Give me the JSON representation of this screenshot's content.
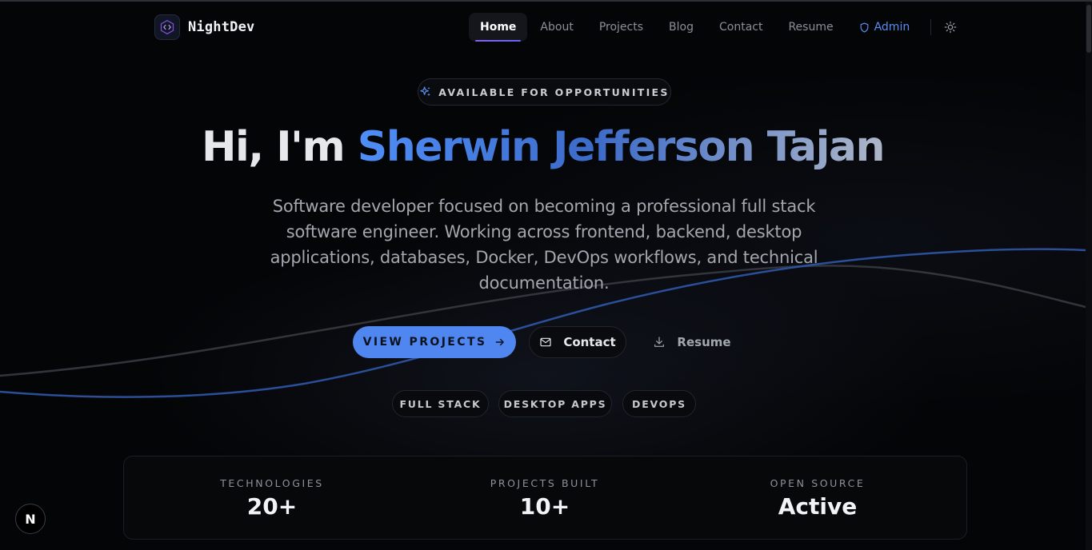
{
  "brand": {
    "name": "NightDev",
    "logo_icon": "code-hexagon-icon"
  },
  "nav": {
    "items": [
      {
        "label": "Home",
        "active": true
      },
      {
        "label": "About"
      },
      {
        "label": "Projects"
      },
      {
        "label": "Blog"
      },
      {
        "label": "Contact"
      },
      {
        "label": "Resume"
      }
    ],
    "admin_label": "Admin",
    "admin_icon": "shield-icon",
    "theme_icon": "sun-icon"
  },
  "hero": {
    "badge": "AVAILABLE FOR OPPORTUNITIES",
    "badge_icon": "sparkles-icon",
    "title_prefix": "Hi, I'm ",
    "title_name": "Sherwin Jefferson Tajan",
    "description": "Software developer focused on becoming a professional full stack software engineer. Working across frontend, backend, desktop applications, databases, Docker, DevOps workflows, and technical documentation."
  },
  "actions": {
    "primary": "VIEW PROJECTS",
    "primary_icon": "arrow-right-icon",
    "contact": "Contact",
    "contact_icon": "mail-icon",
    "resume": "Resume",
    "resume_icon": "download-icon"
  },
  "tags": [
    "FULL STACK",
    "DESKTOP APPS",
    "DEVOPS"
  ],
  "stats": [
    {
      "label": "TECHNOLOGIES",
      "value": "20+"
    },
    {
      "label": "PROJECTS BUILT",
      "value": "10+"
    },
    {
      "label": "OPEN SOURCE",
      "value": "Active"
    }
  ],
  "dev_indicator": "N",
  "colors": {
    "background": "#040507",
    "accent": "#4f86f0",
    "admin": "#5b8def",
    "nav_active_underline": "#8b5cf6"
  }
}
